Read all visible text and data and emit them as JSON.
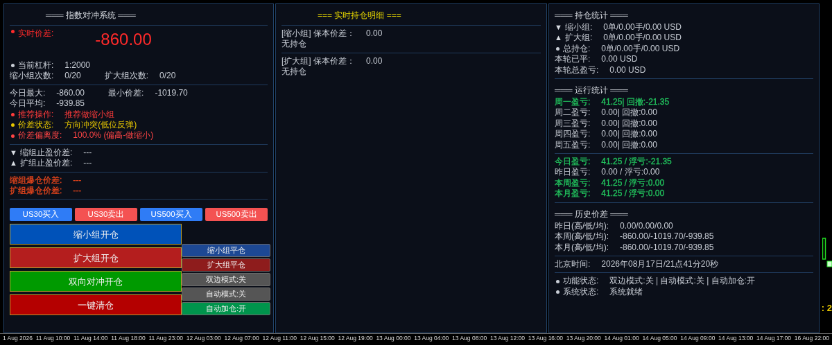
{
  "panels": [
    {
      "sections": [
        {
          "title": {
            "text": "═══ 指数对冲系统 ═══",
            "highlight": false
          }
        },
        {
          "lines": [
            {
              "kind": "big",
              "bullet": true,
              "color": "#ff2a2a",
              "pairs": [
                {
                  "label": "实时价差:",
                  "value": "-860.00"
                }
              ]
            },
            {
              "kind": "plain",
              "bullet": true,
              "pairs": [
                {
                  "label": "当前杠杆:",
                  "value": "1:2000"
                }
              ]
            },
            {
              "kind": "plain",
              "bullet": false,
              "pairs": [
                {
                  "label": "缩小组次数:",
                  "value": "0/20"
                },
                {
                  "label": "扩大组次数:",
                  "value": "0/20"
                }
              ]
            }
          ]
        },
        {
          "lines": [
            {
              "kind": "plain",
              "bullet": false,
              "pairs": [
                {
                  "label": "今日最大:",
                  "value": "-860.00"
                },
                {
                  "label": "最小价差:",
                  "value": "-1019.70"
                }
              ]
            },
            {
              "kind": "plain",
              "bullet": false,
              "pairs": [
                {
                  "label": "今日平均:",
                  "value": "-939.85"
                }
              ]
            },
            {
              "kind": "plain",
              "bullet": true,
              "color": "#ff3b3b",
              "pairs": [
                {
                  "label": "推荐操作:",
                  "value": "推荐做缩小组"
                }
              ]
            },
            {
              "kind": "plain",
              "bullet": true,
              "color": "#e8c800",
              "pairs": [
                {
                  "label": "价差状态:",
                  "value": "方向冲突(低位反弹)"
                }
              ]
            },
            {
              "kind": "plain",
              "bullet": true,
              "color": "#ff4545",
              "pairs": [
                {
                  "label": "价差偏离度:",
                  "value": "100.0% (偏高-做缩小)"
                }
              ]
            }
          ]
        },
        {
          "lines": [
            {
              "kind": "plain",
              "bullet": false,
              "marker": "▼",
              "pairs": [
                {
                  "label": "缩组止盈价差:",
                  "value": "---"
                }
              ]
            },
            {
              "kind": "plain",
              "bullet": false,
              "marker": "▲",
              "pairs": [
                {
                  "label": "扩组止盈价差:",
                  "value": "---"
                }
              ]
            }
          ]
        },
        {
          "lines": [
            {
              "kind": "plain",
              "bullet": false,
              "color": "#e8461c",
              "pairs": [
                {
                  "label": "缩组爆仓价差:",
                  "value": "---"
                }
              ]
            },
            {
              "kind": "plain",
              "bullet": false,
              "color": "#e8461c",
              "pairs": [
                {
                  "label": "扩组爆仓价差:",
                  "value": "---"
                }
              ]
            }
          ]
        }
      ],
      "controls": {
        "quick": [
          {
            "label": "US30买入",
            "color": "#2f7cf6"
          },
          {
            "label": "US30卖出",
            "color": "#f45252"
          },
          {
            "label": "US500买入",
            "color": "#2f7cf6"
          },
          {
            "label": "US500卖出",
            "color": "#f45252"
          }
        ],
        "main": [
          {
            "label": "缩小组开仓",
            "color": "#0052b9"
          },
          {
            "label": "扩大组开仓",
            "color": "#b41e1e"
          },
          {
            "label": "双向对冲开仓",
            "color": "#009a00"
          },
          {
            "label": "一键清仓",
            "color": "#b40000"
          }
        ],
        "side": [
          {
            "label": "缩小组平仓",
            "color": "#1d4894"
          },
          {
            "label": "扩大组平仓",
            "color": "#8e1c1c"
          },
          {
            "label": "双边模式:关",
            "color": "#555555"
          },
          {
            "label": "自动模式:关",
            "color": "#555555"
          },
          {
            "label": "自动加仓:开",
            "color": "#00944c"
          }
        ]
      }
    },
    {
      "sections": [
        {
          "title": {
            "text": "=== 实时持仓明细 ===",
            "highlight": true
          }
        },
        {
          "lines": [
            {
              "kind": "plain",
              "bullet": false,
              "pairs": [
                {
                  "label": "[缩小组] 保本价差：",
                  "value": "0.00"
                }
              ]
            },
            {
              "kind": "plain",
              "bullet": false,
              "pairs": [
                {
                  "label": "无持仓"
                }
              ]
            }
          ]
        },
        {
          "lines": [
            {
              "kind": "plain",
              "bullet": false,
              "pairs": [
                {
                  "label": "[扩大组] 保本价差：",
                  "value": "0.00"
                }
              ]
            },
            {
              "kind": "plain",
              "bullet": false,
              "pairs": [
                {
                  "label": "无持仓"
                }
              ]
            }
          ]
        }
      ]
    },
    {
      "sections": [
        {
          "title": {
            "text": "═══ 持仓统计 ═══",
            "highlight": false
          },
          "lines": [
            {
              "kind": "plain",
              "bullet": false,
              "marker": "▼",
              "pairs": [
                {
                  "label": "缩小组:",
                  "value": "0单/0.00手/0.00 USD"
                }
              ]
            },
            {
              "kind": "plain",
              "bullet": false,
              "marker": "▲",
              "pairs": [
                {
                  "label": "扩大组:",
                  "value": "0单/0.00手/0.00 USD"
                }
              ]
            },
            {
              "kind": "plain",
              "bullet": true,
              "pairs": [
                {
                  "label": "总持仓:",
                  "value": "0单/0.00手/0.00 USD"
                }
              ]
            },
            {
              "kind": "plain",
              "bullet": false,
              "pairs": [
                {
                  "label": "本轮已平:",
                  "value": "0.00 USD"
                }
              ]
            },
            {
              "kind": "plain",
              "bullet": false,
              "pairs": [
                {
                  "label": "本轮总盈亏:",
                  "value": "0.00 USD"
                }
              ]
            }
          ]
        },
        {
          "title": {
            "text": "═══ 运行统计 ═══",
            "highlight": false
          },
          "lines": [
            {
              "kind": "plain",
              "bullet": false,
              "color": "#22c55e",
              "pairs": [
                {
                  "label": "周一盈亏:",
                  "value": "41.25| 回撤:-21.35"
                }
              ]
            },
            {
              "kind": "plain",
              "bullet": false,
              "pairs": [
                {
                  "label": "周二盈亏:",
                  "value": "0.00| 回撤:0.00"
                }
              ]
            },
            {
              "kind": "plain",
              "bullet": false,
              "pairs": [
                {
                  "label": "周三盈亏:",
                  "value": "0.00| 回撤:0.00"
                }
              ]
            },
            {
              "kind": "plain",
              "bullet": false,
              "pairs": [
                {
                  "label": "周四盈亏:",
                  "value": "0.00| 回撤:0.00"
                }
              ]
            },
            {
              "kind": "plain",
              "bullet": false,
              "pairs": [
                {
                  "label": "周五盈亏:",
                  "value": "0.00| 回撤:0.00"
                }
              ]
            }
          ]
        },
        {
          "lines": [
            {
              "kind": "plain",
              "bullet": false,
              "color": "#22c55e",
              "pairs": [
                {
                  "label": "今日盈亏:",
                  "value": "41.25 / 浮亏:-21.35"
                }
              ]
            },
            {
              "kind": "plain",
              "bullet": false,
              "pairs": [
                {
                  "label": "昨日盈亏:",
                  "value": "0.00 / 浮亏:0.00"
                }
              ]
            },
            {
              "kind": "plain",
              "bullet": false,
              "color": "#22c55e",
              "pairs": [
                {
                  "label": "本周盈亏:",
                  "value": "41.25 / 浮亏:0.00"
                }
              ]
            },
            {
              "kind": "plain",
              "bullet": false,
              "color": "#22c55e",
              "pairs": [
                {
                  "label": "本月盈亏:",
                  "value": "41.25 / 浮亏:0.00"
                }
              ]
            }
          ]
        },
        {
          "title": {
            "text": "═══ 历史价差 ═══",
            "highlight": false
          },
          "lines": [
            {
              "kind": "plain",
              "bullet": false,
              "pairs": [
                {
                  "label": "昨日(高/低/均):",
                  "value": "0.00/0.00/0.00"
                }
              ]
            },
            {
              "kind": "plain",
              "bullet": false,
              "pairs": [
                {
                  "label": "本周(高/低/均):",
                  "value": "-860.00/-1019.70/-939.85"
                }
              ]
            },
            {
              "kind": "plain",
              "bullet": false,
              "pairs": [
                {
                  "label": "本月(高/低/均):",
                  "value": "-860.00/-1019.70/-939.85"
                }
              ]
            }
          ]
        },
        {
          "lines": [
            {
              "kind": "plain",
              "bullet": false,
              "pairs": [
                {
                  "label": "北京时间:",
                  "value": "2026年08月17日/21点41分20秒"
                }
              ]
            }
          ]
        },
        {
          "lines": [
            {
              "kind": "plain",
              "bullet": true,
              "pairs": [
                {
                  "label": "功能状态:",
                  "value": "双边模式:关 | 自动模式:关 | 自动加仓:开"
                }
              ]
            },
            {
              "kind": "plain",
              "bullet": true,
              "pairs": [
                {
                  "label": "系统状态:",
                  "value": "系统就绪"
                }
              ]
            }
          ]
        }
      ]
    }
  ],
  "chart": {
    "price_label": ": 2"
  },
  "time_axis": [
    "1 Aug 2026",
    "11 Aug 10:00",
    "11 Aug 14:00",
    "11 Aug 18:00",
    "11 Aug 23:00",
    "12 Aug 03:00",
    "12 Aug 07:00",
    "12 Aug 11:00",
    "12 Aug 15:00",
    "12 Aug 19:00",
    "13 Aug 00:00",
    "13 Aug 04:00",
    "13 Aug 08:00",
    "13 Aug 12:00",
    "13 Aug 16:00",
    "13 Aug 20:00",
    "14 Aug 01:00",
    "14 Aug 05:00",
    "14 Aug 09:00",
    "14 Aug 13:00",
    "14 Aug 17:00",
    "16 Aug 22:00"
  ]
}
